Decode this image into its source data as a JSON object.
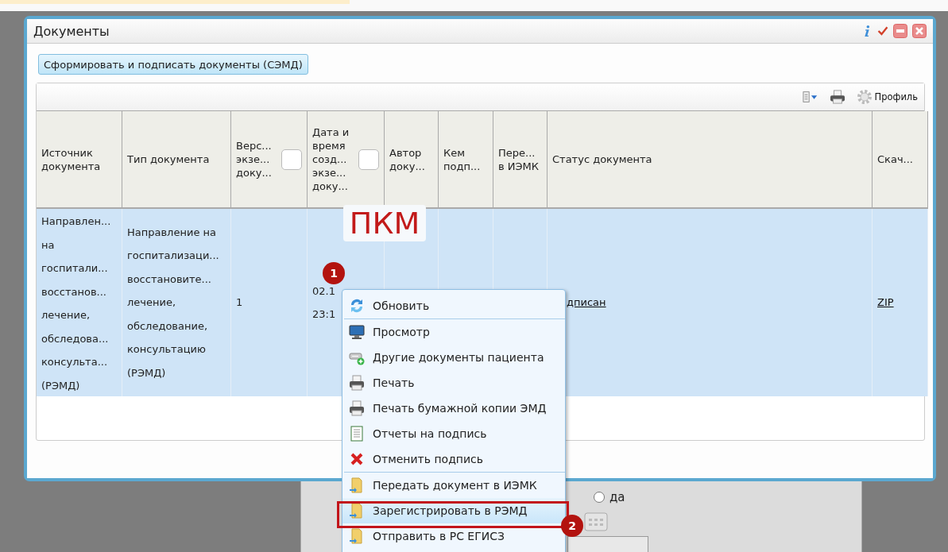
{
  "window": {
    "title": "Документы",
    "action_button": "Сформировать и подписать документы (СЭМД)",
    "profile_button": "Профиль",
    "columns": [
      {
        "label": "Источник документа"
      },
      {
        "label": "Тип документа"
      },
      {
        "label": "Верс... экзе... доку...",
        "checked": false
      },
      {
        "label": "Дата и время созд... экзе... доку...",
        "checked": false
      },
      {
        "label": "Автор доку..."
      },
      {
        "label": "Кем подп..."
      },
      {
        "label": "Пере... в ИЭМК"
      },
      {
        "label": "Статус документа"
      },
      {
        "label": "Скач..."
      }
    ],
    "rows": [
      {
        "selected": true,
        "cells": [
          {
            "kind": "text",
            "text": "Направлен... на госпитали... восстанов... лечение, обследова... консульта... (РЭМД)"
          },
          {
            "kind": "text",
            "text": "Направление на госпитализаци... восстановите... лечение, обследование, консультацию (РЭМД)"
          },
          {
            "kind": "text",
            "text": "1"
          },
          {
            "kind": "text",
            "text": "02.1 23:1"
          },
          {
            "kind": "empty"
          },
          {
            "kind": "empty"
          },
          {
            "kind": "empty"
          },
          {
            "kind": "link",
            "text": "дписан"
          },
          {
            "kind": "link",
            "text": "ZIP"
          }
        ]
      }
    ]
  },
  "context_menu": {
    "items": [
      {
        "kind": "refresh",
        "label": "Обновить",
        "selected": false
      },
      {
        "kind": "separator"
      },
      {
        "kind": "view",
        "label": "Просмотр",
        "selected": false
      },
      {
        "kind": "related",
        "label": "Другие документы пациента",
        "selected": false
      },
      {
        "kind": "print",
        "label": "Печать",
        "selected": false
      },
      {
        "kind": "print",
        "label": "Печать бумажной копии ЭМД",
        "selected": false
      },
      {
        "kind": "report",
        "label": "Отчеты на подпись",
        "selected": false
      },
      {
        "kind": "cancel",
        "label": "Отменить подпись",
        "selected": false
      },
      {
        "kind": "separator"
      },
      {
        "kind": "send",
        "label": "Передать документ в ИЭМК",
        "selected": false
      },
      {
        "kind": "send",
        "label": "Зарегистрировать в РЭМД",
        "selected": true
      },
      {
        "kind": "send",
        "label": "Отправить в РС ЕГИСЗ",
        "selected": false
      }
    ]
  },
  "annotations": {
    "label": "ПКМ",
    "markers": [
      "1",
      "2"
    ]
  },
  "background_form": {
    "radio_label": "да",
    "radio_selected": false
  }
}
